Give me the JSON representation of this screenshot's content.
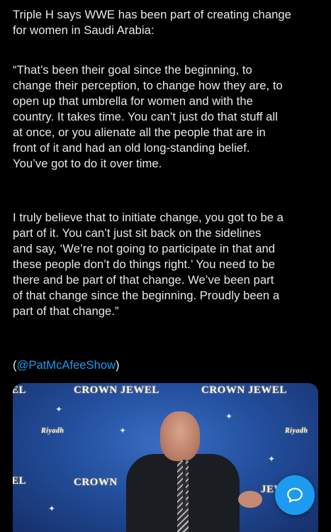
{
  "post": {
    "paragraph_1": "Triple H says WWE has been part of creating change\nfor women in Saudi Arabia:",
    "paragraph_2": "“That’s been their goal since the beginning, to\nchange their perception, to change how they are, to\nopen up that umbrella for women and with the\ncountry. It takes time. You can’t just do that stuff all\nat once, or you alienate all the people that are in\nfront of it and had an old long-standing belief.\nYou’ve got to do it over time.",
    "paragraph_3": "I truly believe that to initiate change, you got to be a\npart of it. You can’t just sit back on the sidelines\nand say, ‘We’re not going to participate in that and\nthese people don’t do things right.’ You need to be\nthere and be part of that change. We’ve been part\nof that change since the beginning. Proudly been a\npart of that change.”",
    "mention_open": "(",
    "mention": "@PatMcAfeeShow",
    "mention_close": ")"
  },
  "media": {
    "backdrop_text_1": "CROWN JEWEL",
    "backdrop_text_2": "CROWN JEWEL",
    "backdrop_text_3": "CROWN",
    "backdrop_text_4": "JEWEL",
    "edge_text_left_top": "EL",
    "edge_text_left_bottom": "EL",
    "sponsor_logo_1": "Riyadh",
    "sponsor_logo_2": "Riyadh"
  },
  "fab": {
    "icon": "compose-reply-icon"
  },
  "colors": {
    "background": "#000000",
    "text": "#e7e9ea",
    "link": "#1d9bf0",
    "fab": "#1d9bf0"
  }
}
